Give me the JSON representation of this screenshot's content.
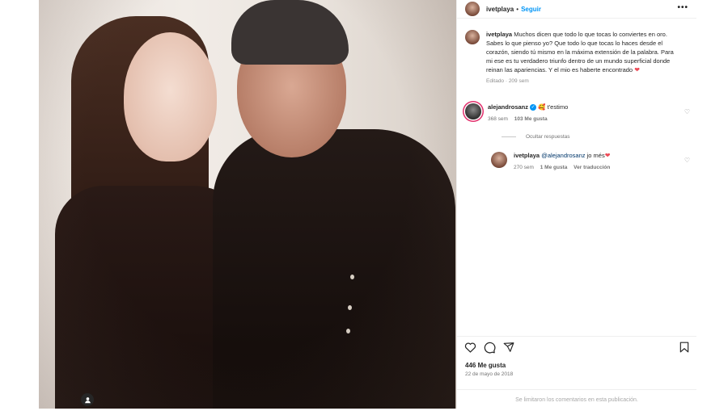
{
  "header": {
    "username": "ivetplaya",
    "separator": "•",
    "follow_label": "Seguir",
    "more_label": "•••"
  },
  "caption": {
    "username": "ivetplaya",
    "text": "Muchos dicen que todo lo que tocas lo conviertes en oro. Sabes lo que pienso yo? Que todo lo que tocas lo haces desde el corazón, siendo tú mismo en la máxima extensión de la palabra. Para mi ese es tu verdadero triunfo dentro de un mundo superficial donde reinan las apariencias. Y el mio es haberte encontrado",
    "heart": "❤",
    "meta": "Editado · 209 sem"
  },
  "comments": [
    {
      "username": "alejandrosanz",
      "verified_mark": "✓",
      "emoji": "🥰",
      "text": "t'estimo",
      "time": "368 sem",
      "likes": "103 Me gusta"
    }
  ],
  "hide_replies_label": "Ocultar respuestas",
  "reply": {
    "username": "ivetplaya",
    "mention": "@alejandrosanz",
    "text": "jo més",
    "heart": "❤",
    "time": "270 sem",
    "likes": "1 Me gusta",
    "translate": "Ver traducción"
  },
  "actions": {
    "like_icon": "♡",
    "comment_icon": "◯",
    "share_icon": "➤",
    "save_icon": "⛉"
  },
  "post": {
    "likes": "446 Me gusta",
    "date": "22 de mayo de 2018"
  },
  "footer_text": "Se limitaron los comentarios en esta publicación.",
  "colors": {
    "accent": "#0095f6",
    "heart": "#ed4956",
    "muted": "#737373"
  }
}
